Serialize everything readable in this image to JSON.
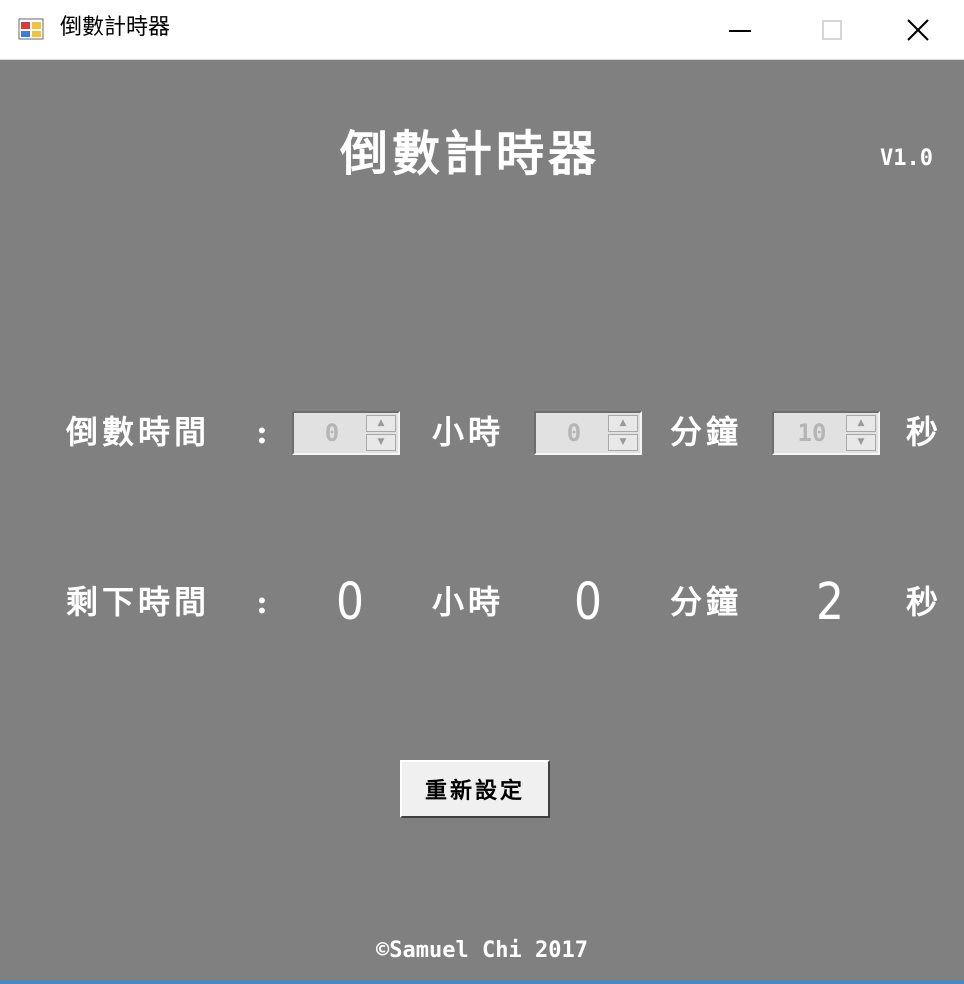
{
  "window": {
    "title": "倒數計時器",
    "icon": "winforms-app-icon",
    "controls": [
      "minimize-icon",
      "maximize-icon",
      "close-icon"
    ]
  },
  "header": {
    "title": "倒數計時器",
    "version": "V1.0"
  },
  "countdown": {
    "label": "倒數時間",
    "colon": ":",
    "hours_value": "0",
    "hours_unit": "小時",
    "minutes_value": "0",
    "minutes_unit": "分鐘",
    "seconds_value": "10",
    "seconds_unit": "秒"
  },
  "remaining": {
    "label": "剩下時間",
    "colon": ":",
    "hours": "0",
    "hours_unit": "小時",
    "minutes": "0",
    "minutes_unit": "分鐘",
    "seconds": "2",
    "seconds_unit": "秒"
  },
  "reset_button": {
    "label": "重新設定"
  },
  "footer": {
    "copyright": "©Samuel Chi 2017"
  },
  "colors": {
    "background": "#808080",
    "text": "#ffffff",
    "spinner_bg": "#e1e1e1",
    "button_bg": "#f0f0f0"
  }
}
